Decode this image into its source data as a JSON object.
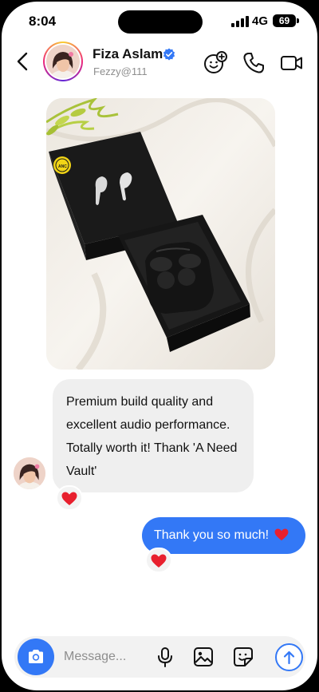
{
  "status_bar": {
    "time": "8:04",
    "network": "4G",
    "battery": "69"
  },
  "header": {
    "contact_name": "Fiza Aslam",
    "contact_handle": "Fezzy@111",
    "icons": [
      "back-icon",
      "verified-badge-icon",
      "add-reaction-icon",
      "phone-icon",
      "video-camera-icon"
    ]
  },
  "messages": {
    "received_text": "Premium build quality and excellent audio performance. Totally worth it! Thank 'A Need Vault'",
    "sent_text": "Thank you so much!",
    "reaction": "heart"
  },
  "product_image": {
    "box_label": "ANC",
    "description_icon": "earbuds-box-photo"
  },
  "composer": {
    "placeholder": "Message...",
    "icons": [
      "camera-icon",
      "microphone-icon",
      "gallery-icon",
      "sticker-icon",
      "send-arrow-icon"
    ]
  },
  "colors": {
    "accent": "#3378f6",
    "bubble_in": "#efefef",
    "heart": "#e8202e"
  }
}
